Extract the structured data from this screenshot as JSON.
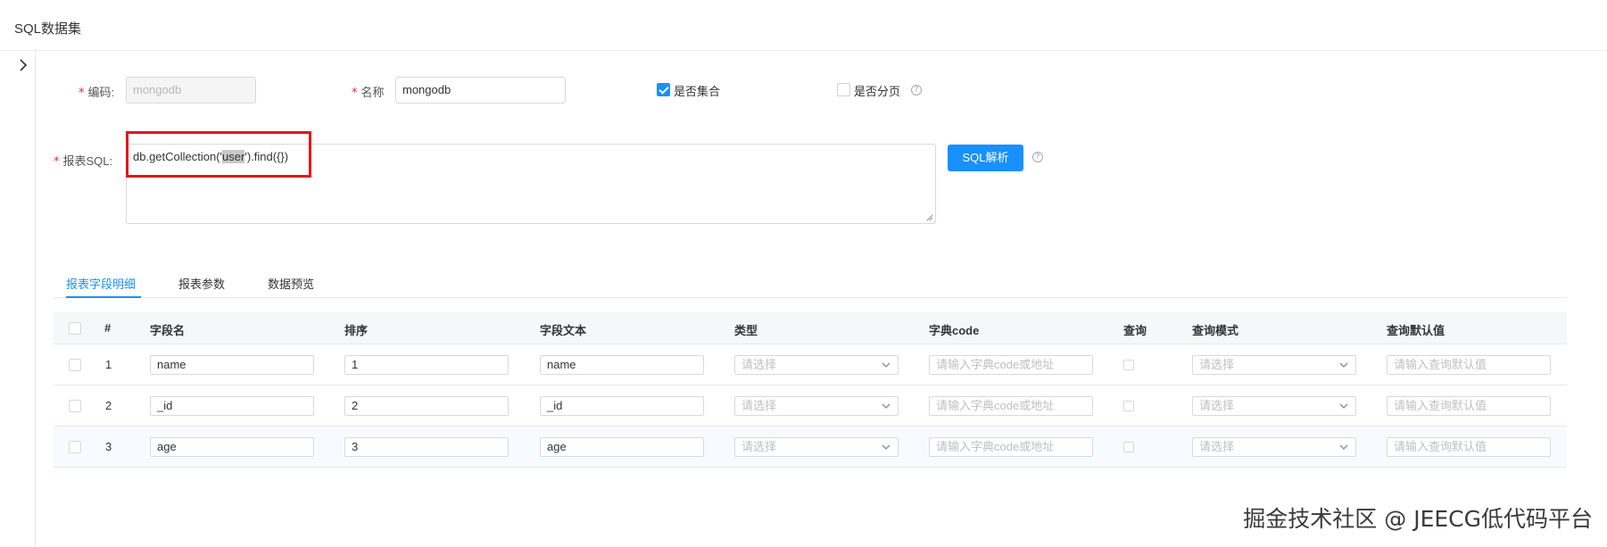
{
  "page": {
    "title": "SQL数据集"
  },
  "form": {
    "code_label": "编码:",
    "code_value": "mongodb",
    "name_label": "名称",
    "name_value": "mongodb",
    "is_collection_label": "是否集合",
    "is_collection_checked": true,
    "is_paging_label": "是否分页",
    "is_paging_checked": false,
    "sql_label": "报表SQL:",
    "sql_prefix": "db.getCollection('",
    "sql_highlight": "user",
    "sql_suffix": "').find({})",
    "sql_parse_button": "SQL解析",
    "required_mark": "*",
    "help_glyph": "?"
  },
  "tabs": [
    {
      "label": "报表字段明细",
      "active": true
    },
    {
      "label": "报表参数",
      "active": false
    },
    {
      "label": "数据预览",
      "active": false
    }
  ],
  "table": {
    "columns": [
      "#",
      "字段名",
      "排序",
      "字段文本",
      "类型",
      "字典code",
      "查询",
      "查询模式",
      "查询默认值"
    ],
    "placeholders": {
      "type": "请选择",
      "dict_code": "请输入字典code或地址",
      "query_mode": "请选择",
      "default_value": "请输入查询默认值"
    },
    "rows": [
      {
        "num": "1",
        "field_name": "name",
        "order": "1",
        "field_text": "name"
      },
      {
        "num": "2",
        "field_name": "_id",
        "order": "2",
        "field_text": "_id"
      },
      {
        "num": "3",
        "field_name": "age",
        "order": "3",
        "field_text": "age"
      }
    ]
  },
  "watermark": "掘金技术社区 @ JEECG低代码平台",
  "colors": {
    "primary": "#1890ff",
    "required": "#f5222d",
    "highlight_border": "#e3161c"
  }
}
